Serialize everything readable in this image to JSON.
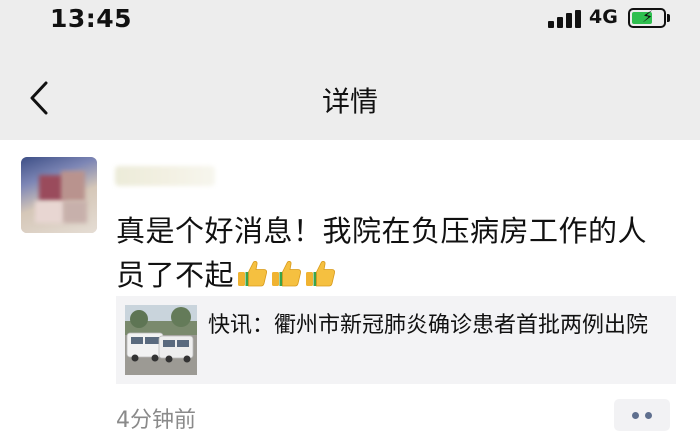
{
  "status_bar": {
    "time": "13:45",
    "network": "4G",
    "signal_icon": "signal-bars-icon",
    "battery_icon": "battery-charging-icon"
  },
  "nav": {
    "back_icon": "chevron-left-icon",
    "title": "详情"
  },
  "post": {
    "text": "真是个好消息！我院在负压病房工作的人员了不起",
    "emoji": [
      "thumbs-up-icon",
      "thumbs-up-icon",
      "thumbs-up-icon"
    ],
    "link": {
      "title": "快讯：衢州市新冠肺炎确诊患者首批两例出院"
    },
    "time": "4分钟前",
    "more_icon": "more-dots-icon"
  },
  "colors": {
    "header_bg": "#ededed",
    "card_bg": "#f3f3f5",
    "time_gray": "#8a8a8a",
    "dots_blue": "#5f6f8e",
    "battery_green": "#2fbf4f"
  }
}
